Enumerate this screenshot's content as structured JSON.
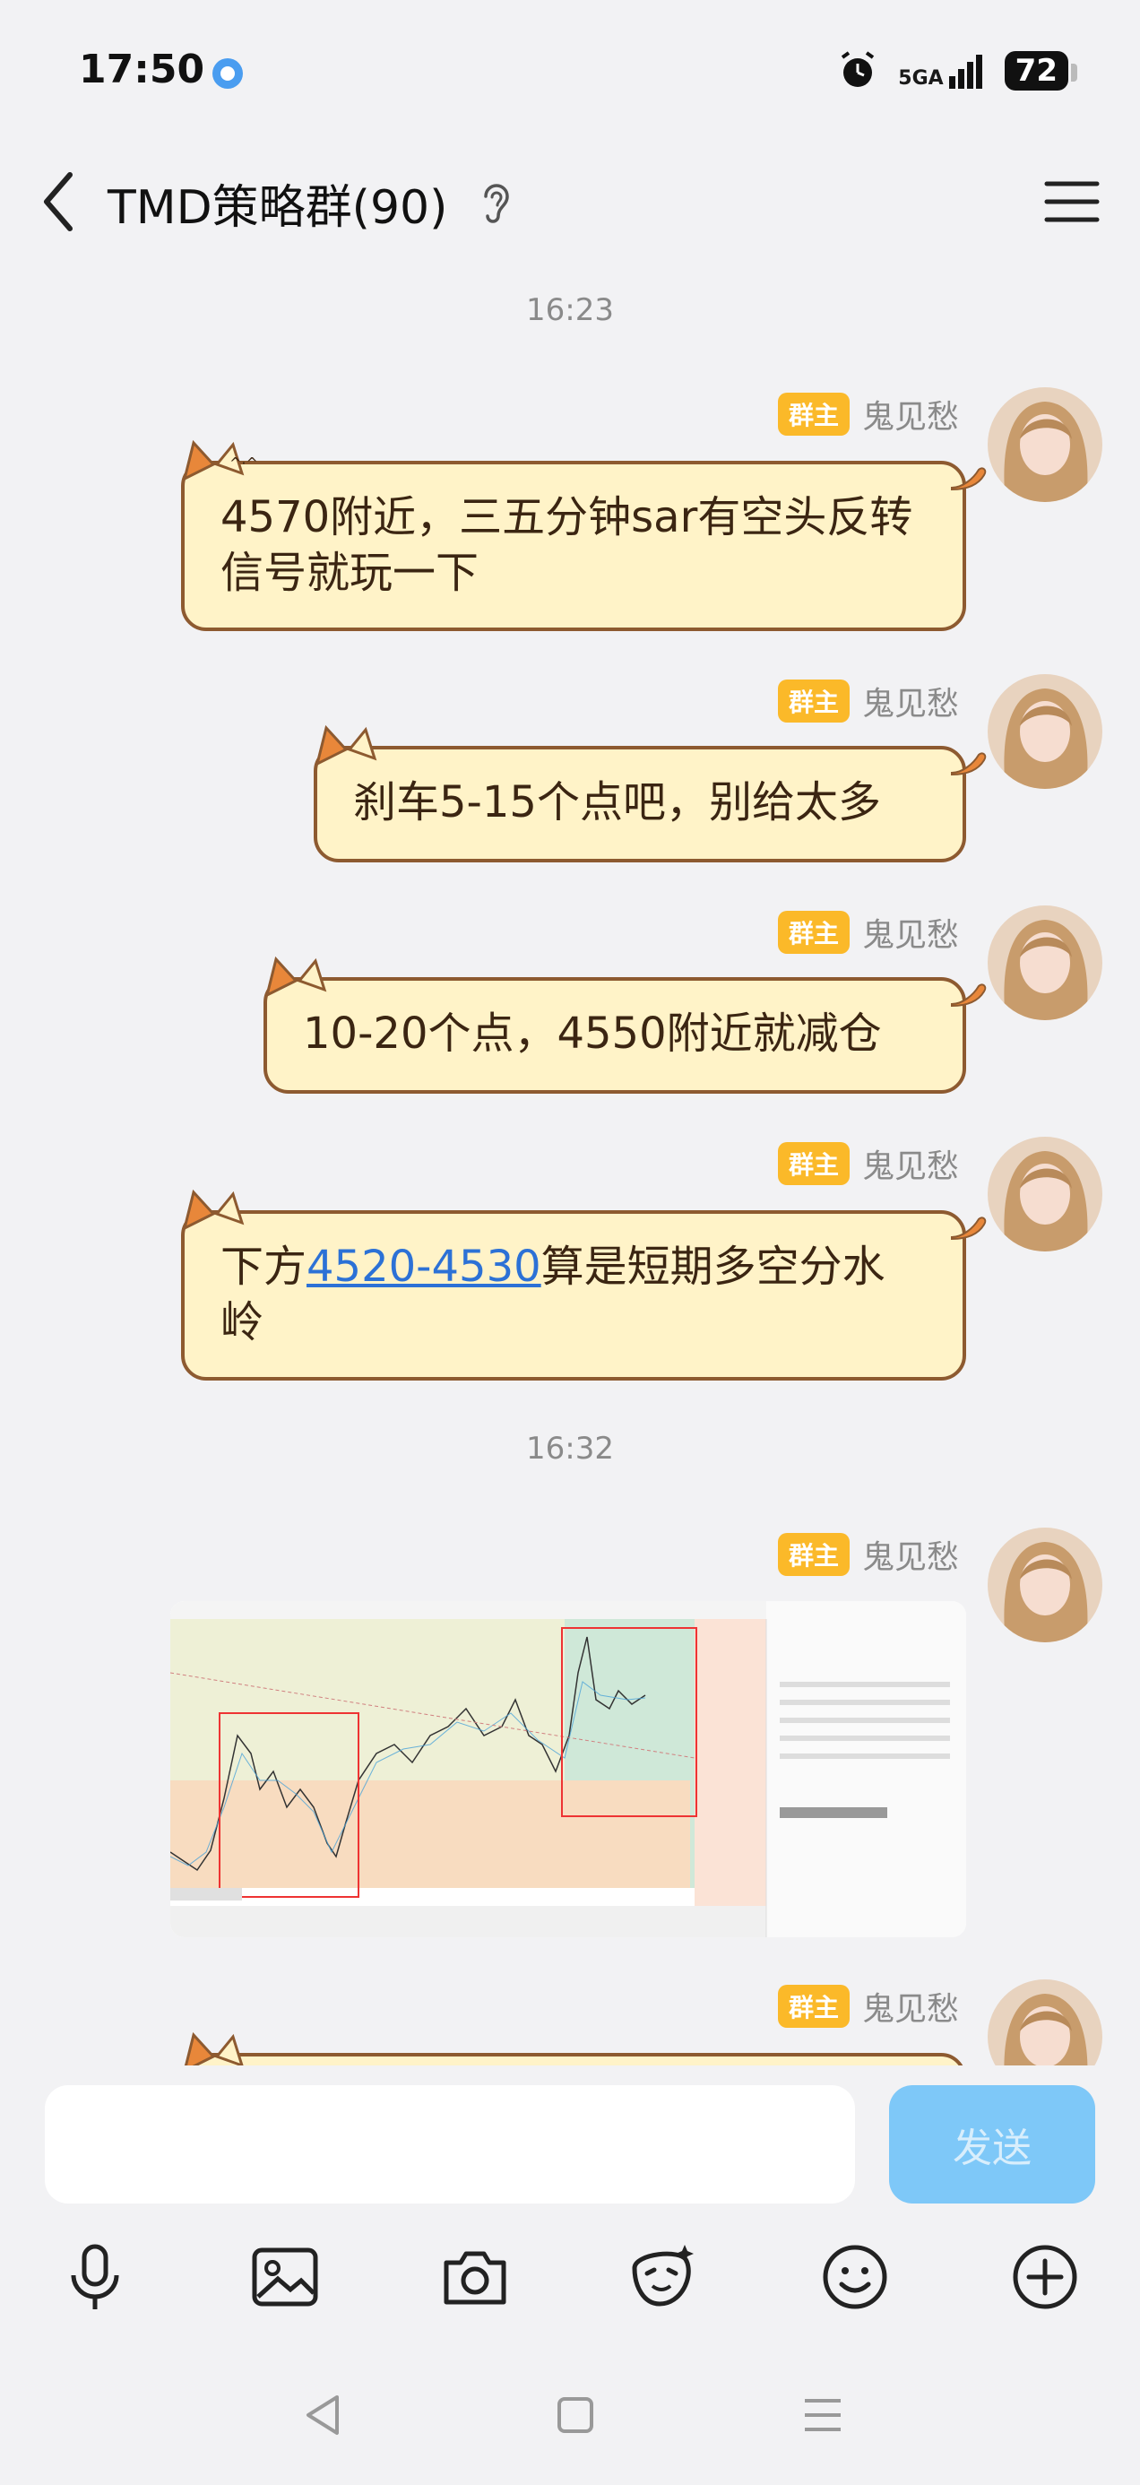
{
  "status": {
    "time": "17:50",
    "network": "5GA",
    "battery": "72"
  },
  "header": {
    "title": "TMD策略群(90)"
  },
  "timestamps": [
    "16:23",
    "16:32"
  ],
  "sender": {
    "badge": "群主",
    "name": "鬼见愁"
  },
  "messages": [
    {
      "text": "4570附近，三五分钟sar有空头反转信号就玩一下"
    },
    {
      "text": "刹车5-15个点吧，别给太多"
    },
    {
      "text": "10-20个点，4550附近就减仓"
    },
    {
      "pre": "下方",
      "link": "4520-4530",
      "post": "算是短期多空分水岭"
    }
  ],
  "input": {
    "send_label": "发送"
  },
  "icons": [
    "back-icon",
    "ear-icon",
    "menu-icon",
    "mic-icon",
    "image-icon",
    "camera-icon",
    "sticker-icon",
    "emoji-icon",
    "plus-icon"
  ],
  "colors": {
    "bubble_bg": "#fff3c8",
    "bubble_border": "#8d5a30",
    "badge": "#fbb929",
    "send": "#7ec8f8",
    "link": "#2c71d6"
  }
}
